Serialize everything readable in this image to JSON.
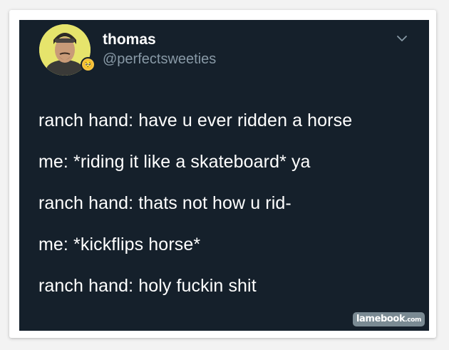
{
  "tweet": {
    "display_name": "thomas",
    "handle": "@perfectsweeties",
    "avatar_badge_emoji": "🥺",
    "lines": [
      "ranch hand: have u ever ridden a horse",
      "me: *riding it like a skateboard* ya",
      "ranch hand: thats not how u rid-",
      "me: *kickflips horse*",
      "ranch hand: holy fuckin shit"
    ],
    "menu_icon": "chevron-down-icon"
  },
  "watermark": {
    "brand": "lamebook",
    "domain": ".com"
  },
  "colors": {
    "background": "#15202b",
    "text": "#ffffff",
    "secondary": "#8899a6"
  }
}
